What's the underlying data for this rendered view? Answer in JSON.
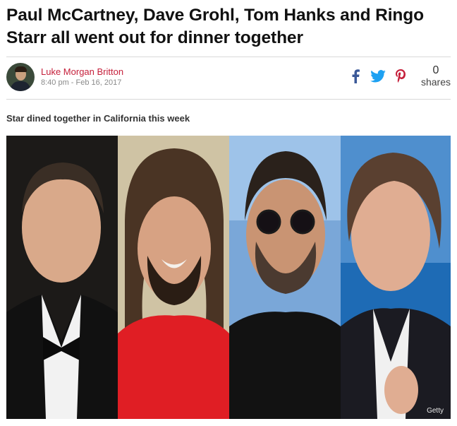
{
  "article": {
    "headline": "Paul McCartney, Dave Grohl, Tom Hanks and Ringo Starr all went out for dinner together",
    "author": "Luke Morgan Britton",
    "timestamp": "8:40 pm - Feb 16, 2017",
    "standfirst": "Star dined together in California this week",
    "image_credit": "Getty"
  },
  "share": {
    "count": "0",
    "label": "shares",
    "icons": [
      "facebook-icon",
      "twitter-icon",
      "pinterest-icon"
    ],
    "colors": {
      "facebook": "#3b5998",
      "twitter": "#1da1f2",
      "pinterest": "#c51f3a"
    }
  },
  "colors": {
    "author": "#c51f3a",
    "divider": "#d9d9d9"
  }
}
